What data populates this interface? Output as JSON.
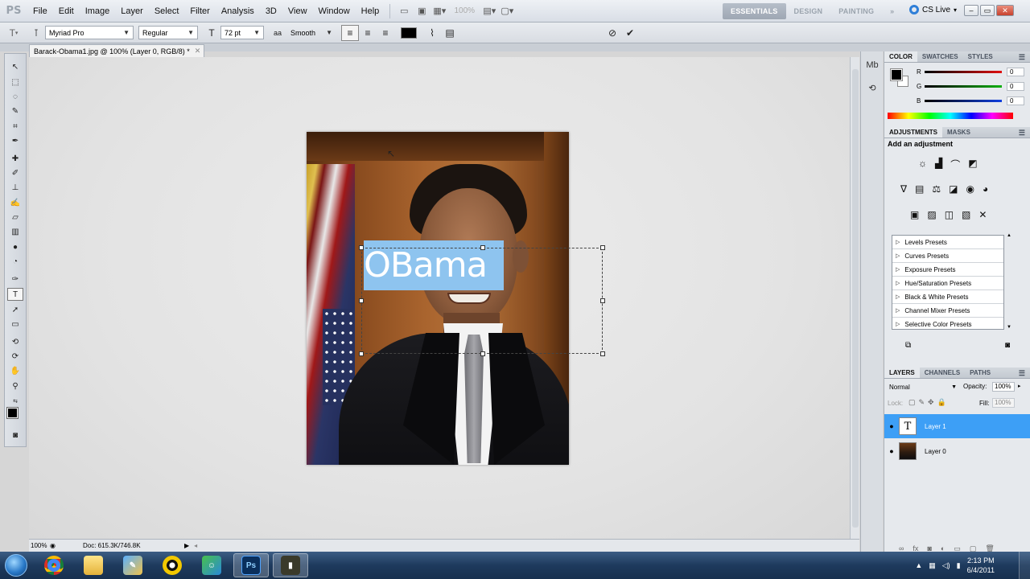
{
  "menubar": {
    "logo": "PS",
    "items": [
      "File",
      "Edit",
      "Image",
      "Layer",
      "Select",
      "Filter",
      "Analysis",
      "3D",
      "View",
      "Window",
      "Help"
    ],
    "zoom": "100%",
    "workspaces": [
      "ESSENTIALS",
      "DESIGN",
      "PAINTING"
    ],
    "cs_live": "CS Live"
  },
  "options": {
    "font_family": "Myriad Pro",
    "font_style": "Regular",
    "font_size": "72 pt",
    "antialias": "Smooth"
  },
  "document": {
    "tab_title": "Barack-Obama1.jpg @ 100% (Layer 0, RGB/8) *",
    "text_content": "OBama",
    "status_zoom": "100%",
    "status_doc": "Doc: 615.3K/746.8K"
  },
  "color_panel": {
    "tabs": [
      "COLOR",
      "SWATCHES",
      "STYLES"
    ],
    "channels": [
      {
        "label": "R",
        "value": "0",
        "color": "#e01010"
      },
      {
        "label": "G",
        "value": "0",
        "color": "#10b010"
      },
      {
        "label": "B",
        "value": "0",
        "color": "#1040e0"
      }
    ]
  },
  "adjustments_panel": {
    "tabs": [
      "ADJUSTMENTS",
      "MASKS"
    ],
    "title": "Add an adjustment",
    "presets": [
      "Levels Presets",
      "Curves Presets",
      "Exposure Presets",
      "Hue/Saturation Presets",
      "Black & White Presets",
      "Channel Mixer Presets",
      "Selective Color Presets"
    ]
  },
  "layers_panel": {
    "tabs": [
      "LAYERS",
      "CHANNELS",
      "PATHS"
    ],
    "blend_mode": "Normal",
    "opacity_label": "Opacity:",
    "opacity": "100%",
    "lock_label": "Lock:",
    "fill_label": "Fill:",
    "fill": "100%",
    "layers": [
      {
        "name": "Layer 1",
        "type_glyph": "T"
      },
      {
        "name": "Layer 0"
      }
    ]
  },
  "taskbar": {
    "clock_time": "2:13 PM",
    "clock_date": "6/4/2011"
  }
}
